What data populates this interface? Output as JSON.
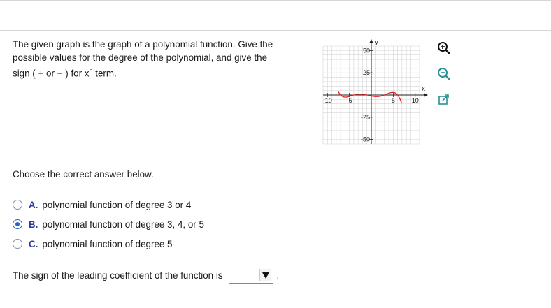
{
  "question": {
    "line1": "The given graph is the graph of a polynomial function. Give the",
    "line2": "possible values for the degree of the polynomial, and give the",
    "line3_pre": "sign (",
    "plus": "+",
    "or": "or",
    "minus": "−",
    "line3_mid": ") for x",
    "sup": "n",
    "line3_post": " term."
  },
  "graph": {
    "y_axis_label": "y",
    "x_axis_label": "x",
    "x_ticks": [
      "-10",
      "-5",
      "5",
      "10"
    ],
    "y_ticks": [
      "50",
      "25",
      "-25",
      "-50"
    ],
    "xlim": [
      -11,
      11
    ],
    "ylim": [
      -55,
      55
    ],
    "curve_color": "#e02020",
    "grid": true
  },
  "tools": [
    {
      "name": "zoom-in-icon"
    },
    {
      "name": "zoom-out-icon"
    },
    {
      "name": "open-external-icon"
    }
  ],
  "choose_prompt": "Choose the correct answer below.",
  "options": [
    {
      "letter": "A.",
      "text": "polynomial function of degree 3 or 4",
      "selected": false
    },
    {
      "letter": "B.",
      "text": "polynomial function of degree 3, 4, or 5",
      "selected": true
    },
    {
      "letter": "C.",
      "text": "polynomial function of degree 5",
      "selected": false
    }
  ],
  "sign_prompt": "The sign of the leading coefficient of the function is",
  "sign_value": "",
  "sign_suffix": ".",
  "colors": {
    "accent": "#2c62c8",
    "option_letter": "#2e3a98",
    "curve": "#e02020"
  }
}
